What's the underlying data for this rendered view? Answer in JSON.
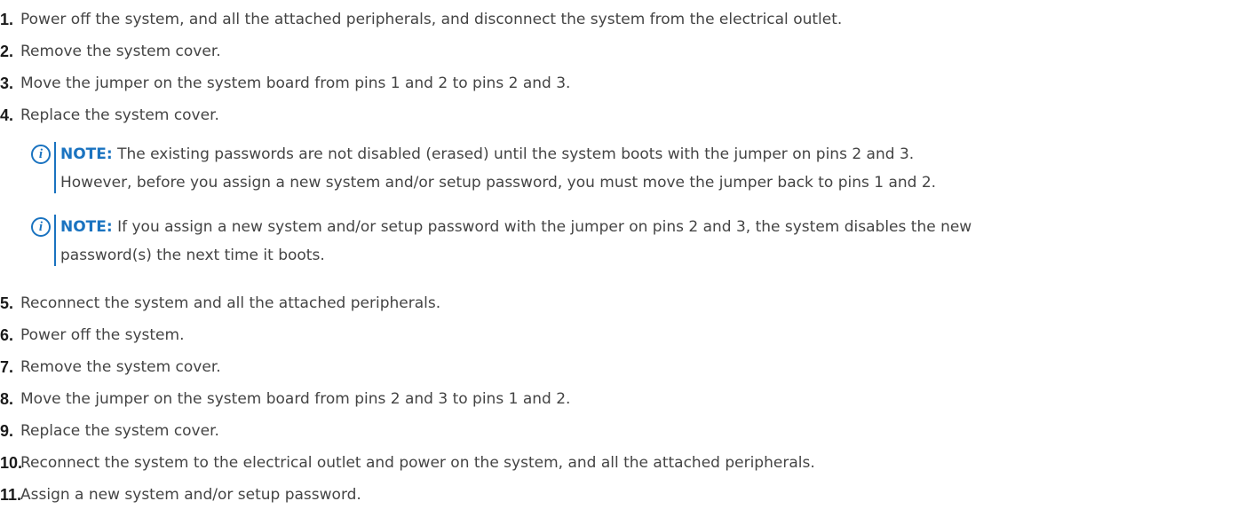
{
  "steps": [
    {
      "number": "1.",
      "text": "Power off the system, and all the attached peripherals, and disconnect the system from the electrical outlet."
    },
    {
      "number": "2.",
      "text": "Remove the system cover."
    },
    {
      "number": "3.",
      "text": "Move the jumper on the system board from pins 1 and 2 to pins 2 and 3."
    },
    {
      "number": "4.",
      "text": "Replace the system cover."
    },
    {
      "number": "5.",
      "text": "Reconnect the system and all the attached peripherals."
    },
    {
      "number": "6.",
      "text": "Power off the system."
    },
    {
      "number": "7.",
      "text": "Remove the system cover."
    },
    {
      "number": "8.",
      "text": "Move the jumper on the system board from pins 2 and 3 to pins 1 and 2."
    },
    {
      "number": "9.",
      "text": "Replace the system cover."
    },
    {
      "number": "10.",
      "text": "Reconnect the system to the electrical outlet and power on the system, and all the attached peripherals."
    },
    {
      "number": "11.",
      "text": "Assign a new system and/or setup password."
    }
  ],
  "notes": [
    {
      "icon": "info-icon",
      "icon_glyph": "i",
      "label": "NOTE:",
      "line1": "The existing passwords are not disabled (erased) until the system boots with the jumper on pins 2 and 3.",
      "line2": "However, before you assign a new system and/or setup password, you must move the jumper back to pins 1 and 2."
    },
    {
      "icon": "info-icon",
      "icon_glyph": "i",
      "label": "NOTE:",
      "line1": "If you assign a new system and/or setup password with the jumper on pins 2 and 3, the system disables the new",
      "line2": "password(s) the next time it boots."
    }
  ],
  "colors": {
    "text": "#444444",
    "number": "#1a1a1a",
    "accent": "#1a73c0"
  }
}
